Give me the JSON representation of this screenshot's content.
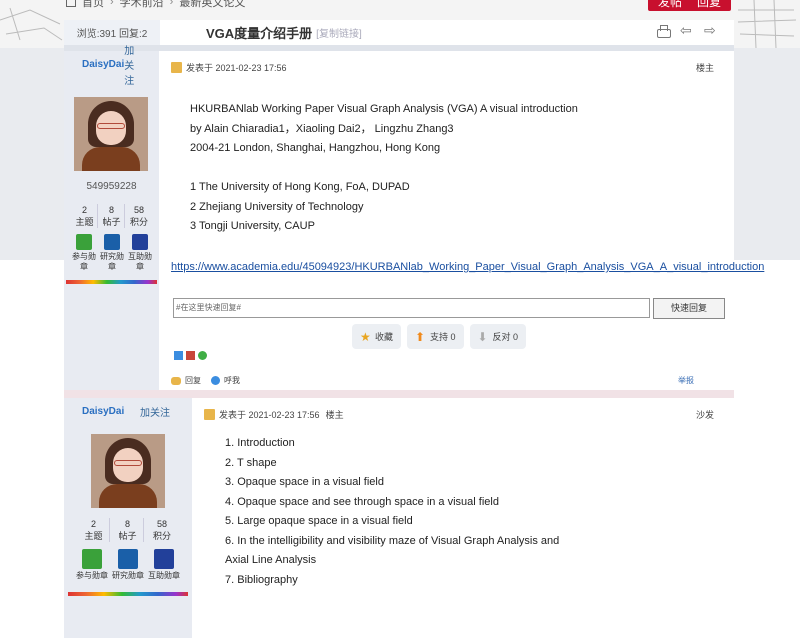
{
  "breadcrumb": [
    "首页",
    "学术前沿",
    "最新英文论文"
  ],
  "top_buttons": {
    "post": "发帖",
    "reply": "回复"
  },
  "thread": {
    "stats": "浏览:391   回复:2",
    "title": "VGA度量介绍手册",
    "copy_link": "[复制链接]"
  },
  "post1": {
    "author": "DaisyDai",
    "follow": "加关注",
    "uid": "549959228",
    "counts": [
      {
        "value": "2",
        "label": "主题"
      },
      {
        "value": "8",
        "label": "帖子"
      },
      {
        "value": "58",
        "label": "积分"
      }
    ],
    "badges": [
      "参与勋章",
      "研究勋章",
      "互助勋章"
    ],
    "posted": "发表于 2021-02-23 17:56",
    "floor": "楼主",
    "lines": [
      "HKURBANlab Working Paper Visual Graph Analysis (VGA) A visual introduction",
      "by Alain Chiaradia1，Xiaoling Dai2， Lingzhu Zhang3",
      "2004-21 London, Shanghai, Hangzhou, Hong Kong",
      "",
      "1 The University of Hong Kong, FoA, DUPAD",
      "2 Zhejiang University of Technology",
      "3 Tongji University, CAUP"
    ],
    "link": "https://www.academia.edu/45094923/HKURBANlab_Working_Paper_Visual_Graph_Analysis_VGA_A_visual_introduction",
    "reply_placeholder": "#在这里快速回复#",
    "reply_button": "快速回复",
    "actions": {
      "favorite": "收藏",
      "support": "支持 0",
      "oppose": "反对 0"
    },
    "footer": {
      "reply": "回复",
      "poke": "呼我",
      "report": "举报"
    }
  },
  "post2": {
    "author": "DaisyDai",
    "follow": "加关注",
    "counts": [
      {
        "value": "2",
        "label": "主题"
      },
      {
        "value": "8",
        "label": "帖子"
      },
      {
        "value": "58",
        "label": "积分"
      }
    ],
    "badges": [
      "参与勋章",
      "研究勋章",
      "互助勋章"
    ],
    "posted": "发表于 2021-02-23 17:56",
    "author_tag": "楼主",
    "floor": "沙发",
    "lines": [
      "1. Introduction",
      "2. T shape",
      "3. Opaque space in a visual field",
      "4. Opaque space and see through space in a visual field",
      "5. Large opaque space in a visual field",
      "6. In the intelligibility and visibility maze of Visual Graph Analysis and",
      "Axial Line Analysis",
      "7. Bibliography"
    ]
  }
}
